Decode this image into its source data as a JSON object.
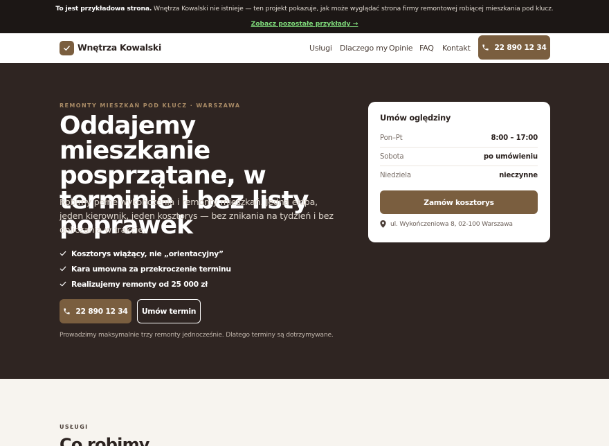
{
  "demo_banner": {
    "bold": "To jest przykładowa strona.",
    "text": " Wnętrza Kowalski nie istnieje — ten projekt pokazuje, jak może wyglądać strona firmy remontowej robiącej mieszkania pod klucz.",
    "link": "Zobacz pozostałe przykłady →"
  },
  "nav": {
    "brand": "Wnętrza Kowalski",
    "items": [
      "Usługi",
      "Dlaczego my",
      "Opinie",
      "FAQ",
      "Kontakt"
    ],
    "phone": "22 890 12 34"
  },
  "hero": {
    "eyebrow": "REMONTY MIESZKAŃ POD KLUCZ · WARSZAWA",
    "title": "Oddajemy mieszkanie posprzątane, w terminie i bez listy poprawek",
    "lead": "Robimy pełne wykończenia i remonty mieszkań. Jedna ekipa, jeden kierownik, jeden kosztorys — bez znikania na tydzień i bez doliczania w trakcie.",
    "checks": [
      "Kosztorys wiążący, nie „orientacyjny”",
      "Kara umowna za przekroczenie terminu",
      "Realizujemy remonty od 25 000 zł"
    ],
    "phone_button": "22 890 12 34",
    "appointment_button": "Umów termin",
    "note": "Prowadzimy maksymalnie trzy remonty jednocześnie. Dlatego terminy są dotrzymywane."
  },
  "card": {
    "title": "Umów oględziny",
    "hours": [
      {
        "day": "Pon–Pt",
        "hours": "8:00 – 17:00"
      },
      {
        "day": "Sobota",
        "hours": "po umówieniu"
      },
      {
        "day": "Niedziela",
        "hours": "nieczynne"
      }
    ],
    "button": "Zamów kosztorys",
    "address": "ul. Wykończeniowa 8, 02-100 Warszawa"
  },
  "services": {
    "eyebrow": "USŁUGI",
    "title": "Co robimy"
  },
  "colors": {
    "accent": "#7a5e3f",
    "hero_bg": "#2f2522",
    "demo_link": "#7ed87a"
  }
}
